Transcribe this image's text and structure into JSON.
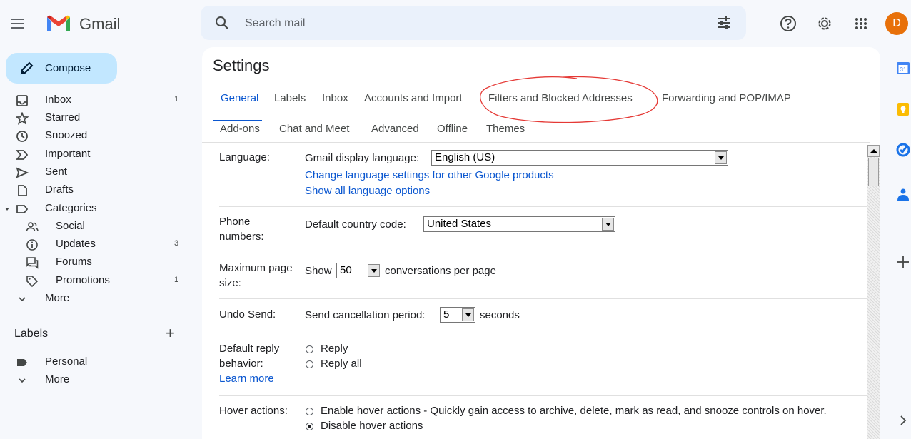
{
  "header": {
    "brand": "Gmail",
    "search_placeholder": "Search mail",
    "avatar_letter": "D"
  },
  "sidebar": {
    "compose_label": "Compose",
    "items": [
      {
        "label": "Inbox",
        "count": "1"
      },
      {
        "label": "Starred",
        "count": ""
      },
      {
        "label": "Snoozed",
        "count": ""
      },
      {
        "label": "Important",
        "count": ""
      },
      {
        "label": "Sent",
        "count": ""
      },
      {
        "label": "Drafts",
        "count": ""
      },
      {
        "label": "Categories",
        "count": ""
      },
      {
        "label": "Social",
        "count": ""
      },
      {
        "label": "Updates",
        "count": "3"
      },
      {
        "label": "Forums",
        "count": ""
      },
      {
        "label": "Promotions",
        "count": "1"
      },
      {
        "label": "More",
        "count": ""
      }
    ],
    "labels_header": "Labels",
    "labels_add": "+",
    "labels": [
      {
        "label": "Personal"
      },
      {
        "label": "More"
      }
    ]
  },
  "settings": {
    "title": "Settings",
    "tabs_row1": [
      "General",
      "Labels",
      "Inbox",
      "Accounts and Import",
      "Filters and Blocked Addresses",
      "Forwarding and POP/IMAP"
    ],
    "tabs_row2": [
      "Add-ons",
      "Chat and Meet",
      "Advanced",
      "Offline",
      "Themes"
    ],
    "active_tab": "General",
    "language": {
      "label": "Language:",
      "display_label": "Gmail display language:",
      "value": "English (US)",
      "link1": "Change language settings for other Google products",
      "link2": "Show all language options"
    },
    "phone": {
      "label_line1": "Phone",
      "label_line2": "numbers:",
      "text": "Default country code:",
      "value": "United States"
    },
    "page_size": {
      "label_line1": "Maximum page",
      "label_line2": "size:",
      "show": "Show",
      "value": "50",
      "suffix": "conversations per page"
    },
    "undo_send": {
      "label": "Undo Send:",
      "text": "Send cancellation period:",
      "value": "5",
      "suffix": "seconds"
    },
    "reply": {
      "label_line1": "Default reply",
      "label_line2": "behavior:",
      "learn_more": "Learn more",
      "opt1": "Reply",
      "opt2": "Reply all"
    },
    "hover": {
      "label": "Hover actions:",
      "opt1": "Enable hover actions - Quickly gain access to archive, delete, mark as read, and snooze controls on hover.",
      "opt2": "Disable hover actions"
    }
  },
  "colors": {
    "accent": "#0b57d0",
    "compose_bg": "#c2e7ff",
    "annotation": "#e53935",
    "avatar": "#e8710a"
  }
}
